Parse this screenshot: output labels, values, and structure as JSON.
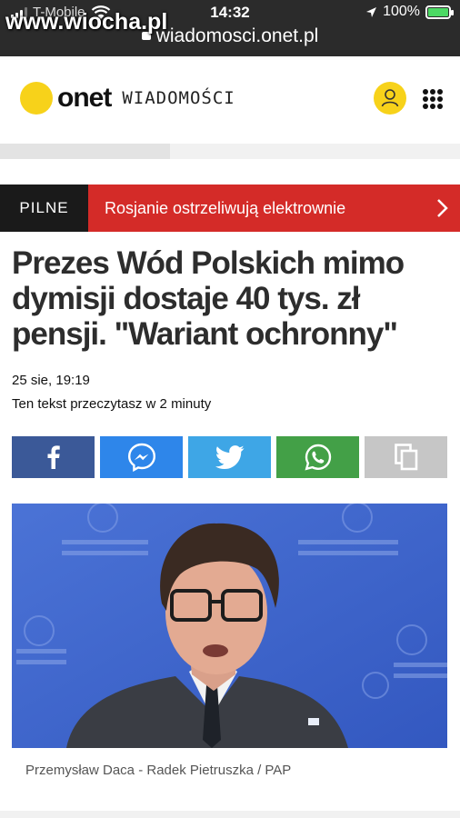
{
  "status_bar": {
    "carrier": "T-Mobile",
    "time": "14:32",
    "battery": "100%",
    "url": "wiadomosci.onet.pl",
    "watermark": "www.wiocha.pl"
  },
  "header": {
    "logo_text": "onet",
    "section": "WIADOMOŚCI",
    "brand_color": "#f7d21a"
  },
  "reading_progress": 0.37,
  "breaking": {
    "tag": "PILNE",
    "headline": "Rosjanie ostrzeliwują elektrownie",
    "color": "#d42b28"
  },
  "article": {
    "title": "Prezes Wód Polskich mimo dymisji dostaje 40 tys. zł pensji. \"Wariant ochronny\"",
    "date": "25 sie, 19:19",
    "read_time": "Ten tekst przeczytasz w 2 minuty",
    "photo_credit": "Przemysław Daca - Radek Pietruszka / PAP"
  },
  "share_buttons": [
    {
      "name": "facebook-icon",
      "color": "#3b5998"
    },
    {
      "name": "messenger-icon",
      "color": "#2e86ea"
    },
    {
      "name": "twitter-icon",
      "color": "#3ea6e6"
    },
    {
      "name": "whatsapp-icon",
      "color": "#43a047"
    },
    {
      "name": "copy-icon",
      "color": "#c6c6c6"
    }
  ]
}
